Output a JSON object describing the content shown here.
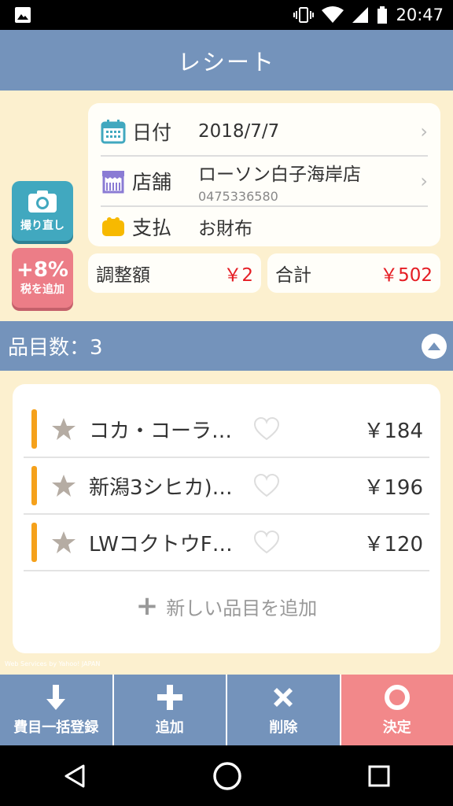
{
  "status": {
    "time": "20:47"
  },
  "appbar": {
    "title": "レシート"
  },
  "receipt": {
    "retake_label": "撮り直し",
    "tax_big": "+8%",
    "tax_label": "税を追加",
    "date_key": "日付",
    "date_value": "2018/7/7",
    "store_key": "店舗",
    "store_name": "ローソン白子海岸店",
    "store_phone": "0475336580",
    "payment_key": "支払",
    "payment_value": "お財布",
    "adjust_key": "調整額",
    "adjust_value": "￥2",
    "total_key": "合計",
    "total_value": "￥502"
  },
  "items": {
    "header": "品目数：3",
    "list": [
      {
        "name": "コカ・コーラ…",
        "price": "￥184"
      },
      {
        "name": "新潟3シヒカ)…",
        "price": "￥196"
      },
      {
        "name": "LWコクトウF…",
        "price": "￥120"
      }
    ],
    "add_label": "新しい品目を追加",
    "credit": "Web Services by Yahoo! JAPAN"
  },
  "toolbar": {
    "bulk_label": "費目一括登録",
    "add_label": "追加",
    "delete_label": "削除",
    "confirm_label": "決定"
  },
  "colors": {
    "primary": "#7493bb",
    "accent_red": "#e51c23",
    "confirm": "#f2888a",
    "background": "#fcf0cf"
  }
}
